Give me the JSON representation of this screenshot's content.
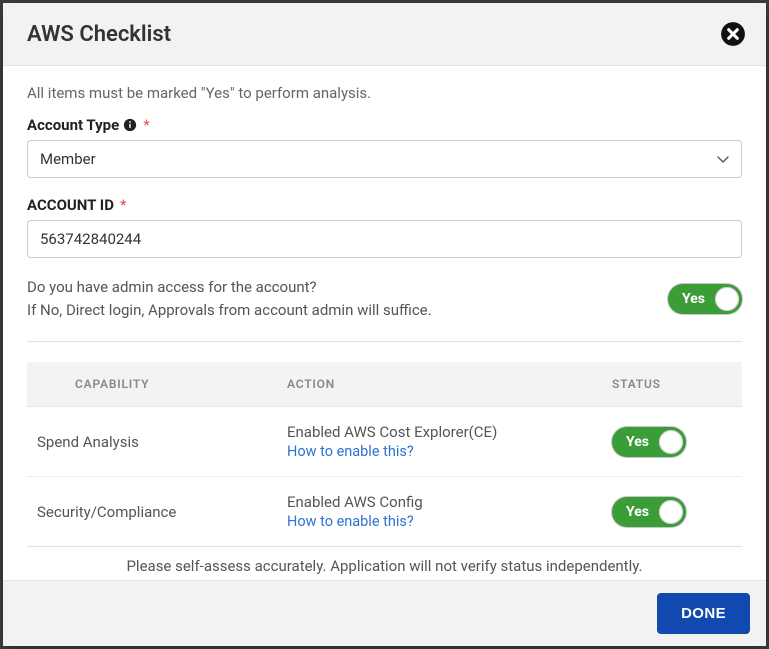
{
  "header": {
    "title": "AWS Checklist"
  },
  "intro": "All items must be marked \"Yes\" to perform analysis.",
  "fields": {
    "account_type": {
      "label": "Account Type",
      "value": "Member"
    },
    "account_id": {
      "label": "ACCOUNT ID",
      "value": "563742840244"
    }
  },
  "admin": {
    "question_line1": "Do you have admin access for the account?",
    "question_line2": "If No, Direct login, Approvals from account admin will suffice.",
    "toggle_label": "Yes"
  },
  "table": {
    "headers": {
      "capability": "CAPABILITY",
      "action": "ACTION",
      "status": "STATUS"
    },
    "rows": [
      {
        "capability": "Spend Analysis",
        "action": "Enabled AWS Cost Explorer(CE)",
        "link": "How to enable this?",
        "toggle": "Yes"
      },
      {
        "capability": "Security/Compliance",
        "action": "Enabled AWS Config",
        "link": "How to enable this?",
        "toggle": "Yes"
      }
    ]
  },
  "assess_note": "Please self-assess accurately. Application will not verify status independently.",
  "footer": {
    "done": "DONE"
  }
}
